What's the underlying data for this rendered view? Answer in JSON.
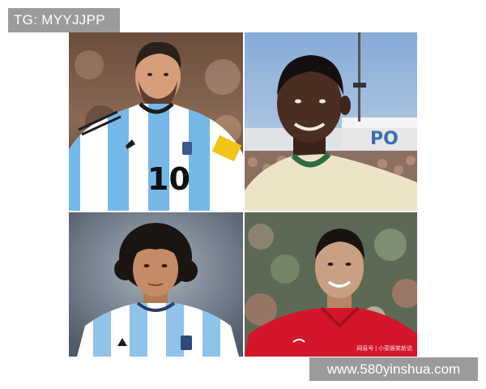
{
  "watermarks": {
    "top_left": "TG: MYYJJPP",
    "bottom_right": "www.580yinshua.com"
  },
  "photos": [
    {
      "jersey_number": "10",
      "jersey_colors": [
        "#74b9e8",
        "#ffffff"
      ],
      "subject_icon": "football-player-photo"
    },
    {
      "stadium_sign": "PO",
      "subject_icon": "football-player-photo"
    },
    {
      "subject_icon": "football-player-photo"
    },
    {
      "photo_credit": "网易号 | 小菜娱笑新说",
      "subject_icon": "football-player-photo"
    }
  ]
}
